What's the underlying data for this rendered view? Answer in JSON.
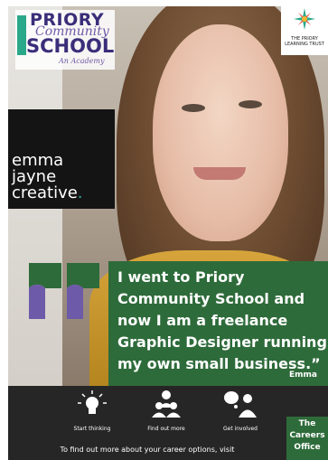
{
  "school_logo": {
    "line1": "PRIORY",
    "line2": "Community",
    "line3": "SCHOOL",
    "tagline": "An Academy"
  },
  "trust_logo": {
    "name": "THE PRIORY LEARNING TRUST"
  },
  "brand": {
    "line1": "emma",
    "line2": "jayne",
    "line3": "creative",
    "dot": "."
  },
  "quote": {
    "text": "I went to Priory Community School and now I am a freelance Graphic Designer running my own small business.”",
    "name": "Emma"
  },
  "footer": {
    "items": [
      {
        "label": "Start thinking",
        "icon": "lightbulb-icon"
      },
      {
        "label": "Find out more",
        "icon": "people-meeting-icon"
      },
      {
        "label": "Get involved",
        "icon": "thought-bubble-icon"
      }
    ],
    "visit_text": "To find out more about your career options, visit",
    "careers_badge": [
      "The",
      "Careers",
      "Office"
    ]
  },
  "colors": {
    "quote_green": "#2e6b3a",
    "footer_dark": "#262626",
    "school_purple": "#3a2e7a",
    "brand_teal": "#3aa8a0"
  }
}
